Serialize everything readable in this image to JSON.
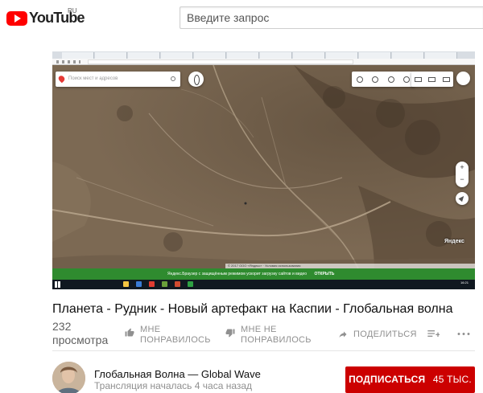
{
  "masthead": {
    "logo_text": "YouTube",
    "logo_region": "RU",
    "search_placeholder": "Введите запрос"
  },
  "player": {
    "map": {
      "search_placeholder": "Поиск мест и адресов",
      "zoom_in": "+",
      "zoom_out": "−",
      "logo": "Яндекс",
      "copyright": "© 2017 ООО «Яндекс» · Условия использования"
    },
    "browser_banner": {
      "text": "Яндекс.Браузер с защищённым режимом ускорит загрузку сайтов и видео",
      "action": "ОТКРЫТЬ"
    },
    "taskbar_clock": "16:21"
  },
  "video": {
    "title": "Планета - Рудник - Новый артефакт на Каспии - Глобальная волна",
    "views_count": "232",
    "views_label": "просмотра",
    "like_label": "МНЕ ПОНРАВИЛОСЬ",
    "dislike_label": "МНЕ НЕ ПОНРАВИЛОСЬ",
    "share_label": "ПОДЕЛИТЬСЯ"
  },
  "channel": {
    "name": "Глобальная Волна — Global Wave",
    "stream_info": "Трансляция началась 4 часа назад",
    "subscribe_label": "ПОДПИСАТЬСЯ",
    "subscriber_count": "45 ТЫС."
  },
  "colors": {
    "brand_red": "#ff0000",
    "subscribe_red": "#cc0000",
    "banner_green": "#2f8b2f"
  }
}
